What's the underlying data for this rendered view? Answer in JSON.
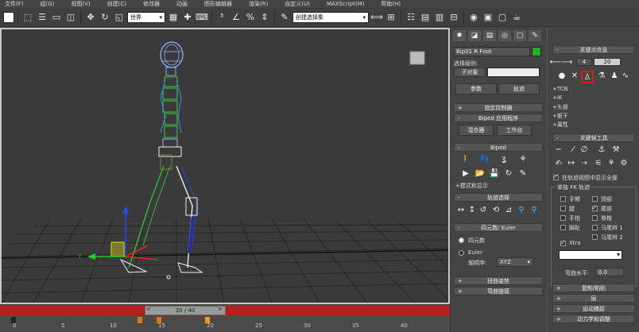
{
  "menu": [
    "文件(F)",
    "组(G)",
    "视图(V)",
    "创建(C)",
    "修改器",
    "动画",
    "图形编辑器",
    "渲染(R)",
    "自定义(U)",
    "MAXScript(M)",
    "帮助(H)"
  ],
  "toolbar": {
    "ref_coord": "世界",
    "selection_set": "创建选择集"
  },
  "object_name": "Bip01 R Foot",
  "object_color": "#20b020",
  "selection_level_label": "选择级别:",
  "selection_level_value": "子对象",
  "params_tabs": [
    "参数",
    "轨迹"
  ],
  "rollouts": {
    "assign_controller": "指定控制器",
    "biped_app": "Biped 应用程序",
    "mixer": "混合器",
    "workbench": "工作台",
    "biped": "Biped",
    "mode_display": "+模式和显示",
    "track_select": "轨迹选择",
    "quat_euler": "四元数/ Euler",
    "quat": "四元数",
    "euler": "Euler",
    "axis_order_label": "轴顺序:",
    "axis_order_value": "XYZ",
    "twist_pose": "扭曲姿势",
    "bend_link": "弯曲链接"
  },
  "keyinfo": {
    "title": "关键点信息",
    "frame_value": "4",
    "time_value": "20",
    "tcb": "+TCB",
    "ik": "+IK",
    "head": "+头部",
    "body": "+躯干",
    "prop": "+属性"
  },
  "keytools": {
    "title": "关键帧工具",
    "show_all_label": "在轨迹视图中显示全部",
    "fk_group": "单独 FK 轨迹",
    "left_items": [
      "手臂",
      "腿",
      "手指",
      "脚趾"
    ],
    "right_items": [
      "颈部",
      "尾部",
      "脊椎",
      "马尾辫 1",
      "马尾辫 2"
    ],
    "checked_right": [
      false,
      true,
      false,
      false,
      false
    ],
    "xtra": "Xtra",
    "bend_label": "弯曲水平:",
    "bend_value": "0.0"
  },
  "bottom_rollouts": [
    "复制/粘贴",
    "层",
    "运动捕捉",
    "动力学和调整"
  ],
  "timeline": {
    "slider_text": "20 / 40",
    "prev": "<",
    "next": ">",
    "ticks": [
      "0",
      "5",
      "10",
      "15",
      "20",
      "25",
      "30",
      "35",
      "40"
    ],
    "keys": [
      0,
      13,
      15,
      20
    ],
    "current": 20
  }
}
